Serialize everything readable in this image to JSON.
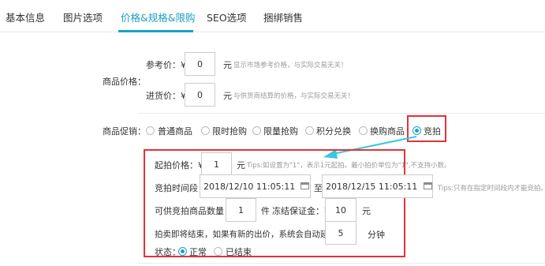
{
  "tabs": [
    {
      "label": "基本信息"
    },
    {
      "label": "图片选项"
    },
    {
      "label": "价格&规格&限购"
    },
    {
      "label": "SEO选项"
    },
    {
      "label": "捆绑销售"
    }
  ],
  "price": {
    "section_label": "商品价格：",
    "reference_label": "参考价：¥",
    "reference_value": "0",
    "reference_unit": "元",
    "reference_hint": "显示市场参考价格，与实际交易无关！",
    "cost_label": "进货价：¥",
    "cost_value": "0",
    "cost_unit": "元",
    "cost_hint": "与供货商结算的价格，与实际交易无关！"
  },
  "promotion": {
    "section_label": "商品促销：",
    "options": [
      {
        "label": "普通商品",
        "checked": false
      },
      {
        "label": "限时抢购",
        "checked": false
      },
      {
        "label": "限量抢购",
        "checked": false
      },
      {
        "label": "积分兑换",
        "checked": false
      },
      {
        "label": "换购商品",
        "checked": false
      },
      {
        "label": "竞拍",
        "checked": true
      }
    ]
  },
  "auction": {
    "start_price_label": "起拍价格：¥",
    "start_price_value": "1",
    "start_price_unit": "元",
    "start_price_hint": "Tips:如设置为\"1\"，表示1元起拍。最小拍价单位为\"1\",不支持小数。",
    "period_label": "竞拍时间段：",
    "start_time": "2018/12/10 11:05:11",
    "to_label": "至",
    "end_time": "2018/12/15 11:05:11",
    "period_hint": "Tips:只有在指定时间段内才能竞拍。",
    "quantity_label": "可供竞拍商品数量：",
    "quantity_value": "1",
    "quantity_unit": "件",
    "deposit_label": "冻结保证金：¥",
    "deposit_value": "10",
    "deposit_unit": "元",
    "extend_label": "拍卖即将结束，如果有新的出价，系统会自动延长",
    "extend_value": "5",
    "extend_unit": "分钟",
    "status_label": "状态：",
    "status_options": [
      {
        "label": "正常",
        "checked": true
      },
      {
        "label": "已结束",
        "checked": false
      }
    ]
  },
  "colors": {
    "accent": "#1aa1c4",
    "highlight_border": "#e3323b"
  }
}
